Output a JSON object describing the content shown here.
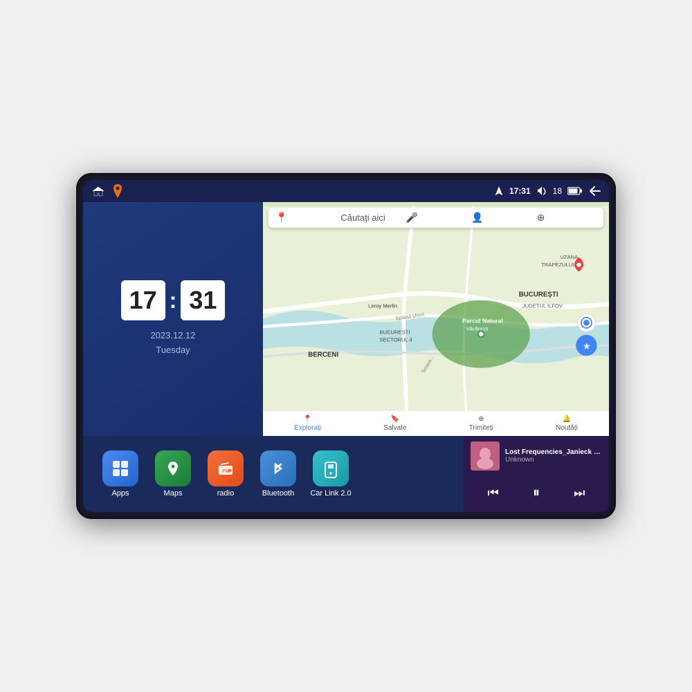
{
  "device": {
    "status_bar": {
      "time": "17:31",
      "signal_bars": "18",
      "back_label": "←"
    },
    "clock": {
      "hours": "17",
      "minutes": "31",
      "date": "2023.12.12",
      "day": "Tuesday"
    },
    "map": {
      "search_placeholder": "Căutați aici",
      "bottom_items": [
        {
          "label": "Explorați",
          "active": true,
          "icon": "📍"
        },
        {
          "label": "Salvate",
          "active": false,
          "icon": "🔖"
        },
        {
          "label": "Trimiteți",
          "active": false,
          "icon": "⊕"
        },
        {
          "label": "Noutăți",
          "active": false,
          "icon": "🔔"
        }
      ]
    },
    "apps": [
      {
        "id": "apps",
        "label": "Apps",
        "icon": "⊞",
        "color_class": "app-apps"
      },
      {
        "id": "maps",
        "label": "Maps",
        "icon": "🗺",
        "color_class": "app-maps"
      },
      {
        "id": "radio",
        "label": "radio",
        "icon": "📻",
        "color_class": "app-radio"
      },
      {
        "id": "bluetooth",
        "label": "Bluetooth",
        "icon": "🔷",
        "color_class": "app-bluetooth"
      },
      {
        "id": "carlink",
        "label": "Car Link 2.0",
        "icon": "📱",
        "color_class": "app-carlink"
      }
    ],
    "music": {
      "title": "Lost Frequencies_Janieck Devy-...",
      "artist": "Unknown",
      "controls": {
        "prev": "⏮",
        "play": "⏸",
        "next": "⏭"
      }
    }
  }
}
